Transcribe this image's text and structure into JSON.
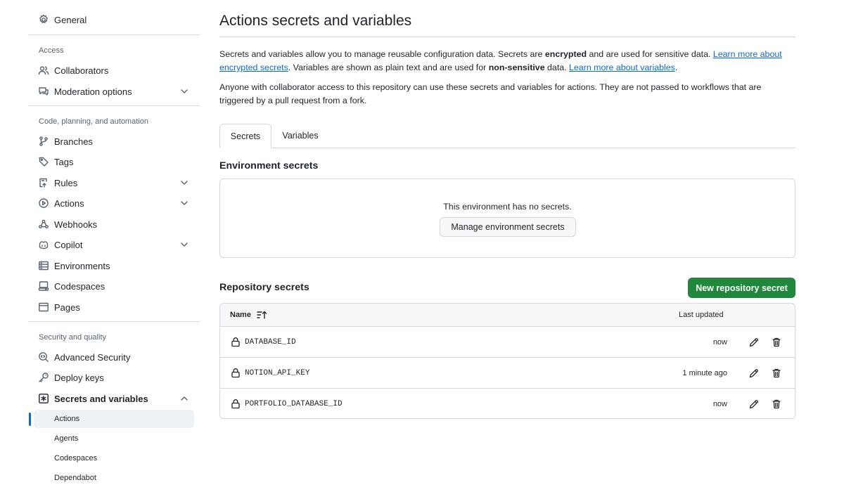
{
  "sidebar": {
    "general": "General",
    "groups": {
      "access": "Access",
      "code": "Code, planning, and automation",
      "security": "Security and quality"
    },
    "items": {
      "collaborators": "Collaborators",
      "moderation": "Moderation options",
      "branches": "Branches",
      "tags": "Tags",
      "rules": "Rules",
      "actions": "Actions",
      "webhooks": "Webhooks",
      "copilot": "Copilot",
      "environments": "Environments",
      "codespaces": "Codespaces",
      "pages": "Pages",
      "advanced_security": "Advanced Security",
      "deploy_keys": "Deploy keys",
      "secrets_and_variables": "Secrets and variables"
    },
    "sub_items": [
      "Actions",
      "Agents",
      "Codespaces",
      "Dependabot"
    ]
  },
  "main": {
    "title": "Actions secrets and variables",
    "intro": {
      "p1_a": "Secrets and variables allow you to manage reusable configuration data. Secrets are ",
      "p1_b": "encrypted",
      "p1_c": " and are used for sensitive data. ",
      "p1_link1": "Learn more about encrypted secrets",
      "p1_d": ". Variables are shown as plain text and are used for ",
      "p1_e": "non-sensitive",
      "p1_f": " data. ",
      "p1_link2": "Learn more about variables",
      "p1_g": ".",
      "p2": "Anyone with collaborator access to this repository can use these secrets and variables for actions. They are not passed to workflows that are triggered by a pull request from a fork."
    },
    "tabs": [
      "Secrets",
      "Variables"
    ],
    "environment": {
      "heading": "Environment secrets",
      "empty": "This environment has no secrets.",
      "manage_button": "Manage environment secrets"
    },
    "repository": {
      "heading": "Repository secrets",
      "new_button": "New repository secret",
      "col_name": "Name",
      "col_updated": "Last updated",
      "rows": [
        {
          "name": "DATABASE_ID",
          "updated": "now"
        },
        {
          "name": "NOTION_API_KEY",
          "updated": "1 minute ago"
        },
        {
          "name": "PORTFOLIO_DATABASE_ID",
          "updated": "now"
        }
      ]
    }
  },
  "colors": {
    "link": "#0969da",
    "primary_button": "#1f883d",
    "border": "#d1d9e0",
    "active_indicator": "#0969da"
  }
}
